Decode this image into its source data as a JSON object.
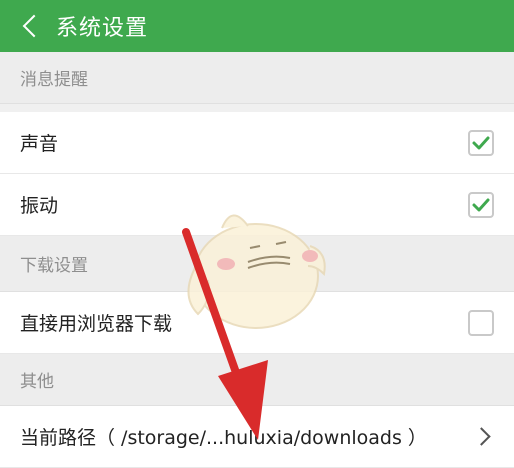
{
  "header": {
    "title": "系统设置"
  },
  "sections": {
    "messages": {
      "title": "消息提醒",
      "sound": {
        "label": "声音",
        "checked": true
      },
      "vibration": {
        "label": "振动",
        "checked": true
      }
    },
    "download": {
      "title": "下载设置",
      "browser": {
        "label": "直接用浏览器下载",
        "checked": false
      }
    },
    "other": {
      "title": "其他",
      "path": {
        "label": "当前路径（ /storage/...huluxia/downloads ）"
      }
    }
  },
  "colors": {
    "header": "#3fa94e",
    "check": "#3fa94e",
    "arrow": "#d92b2b"
  }
}
